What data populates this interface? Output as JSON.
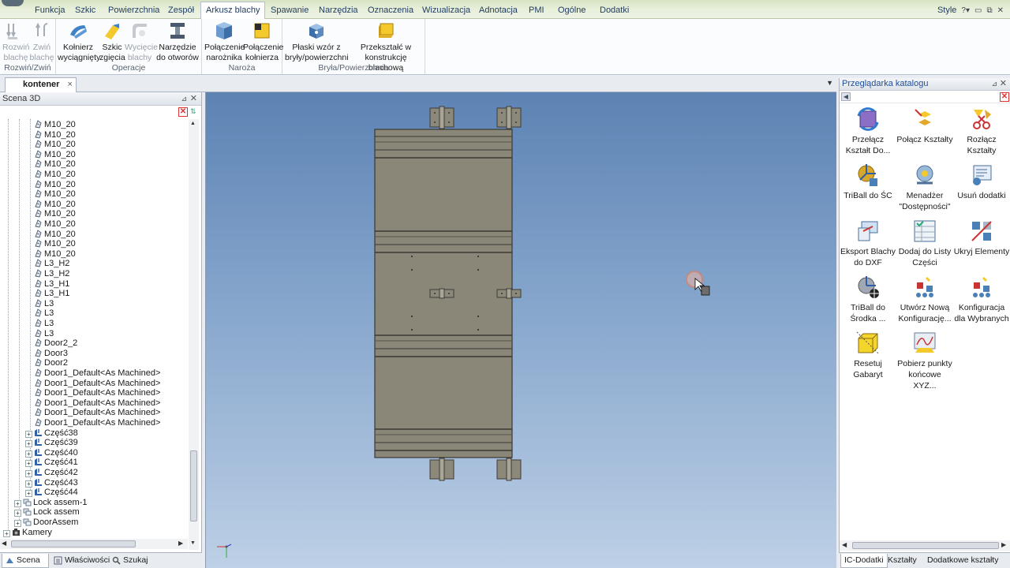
{
  "menu": {
    "tabs": [
      "Funkcja",
      "Szkic",
      "Powierzchnia",
      "Zespół",
      "Arkusz blachy",
      "Spawanie",
      "Narzędzia",
      "Oznaczenia",
      "Wizualizacja",
      "Adnotacja",
      "PMI",
      "Ogólne",
      "Dodatki"
    ],
    "active_tab": "Arkusz blachy",
    "style_label": "Style",
    "help_icon": "help-icon"
  },
  "ribbon": {
    "groups": {
      "rozwin": {
        "label": "Rozwiń/Zwiń",
        "buttons": [
          {
            "line1": "Rozwiń",
            "line2": "blachę",
            "enabled": false
          },
          {
            "line1": "Zwiń",
            "line2": "blachę",
            "enabled": false
          }
        ]
      },
      "operacje": {
        "label": "Operacje",
        "buttons": [
          {
            "line1": "Kołnierz",
            "line2": "wyciągnięty",
            "enabled": true
          },
          {
            "line1": "Szkic",
            "line2": "zgięcia",
            "enabled": true
          },
          {
            "line1": "Wycięcie",
            "line2": "blachy",
            "enabled": false
          },
          {
            "line1": "Narzędzie",
            "line2": "do otworów",
            "enabled": true
          }
        ]
      },
      "naroza": {
        "label": "Naroża",
        "buttons": [
          {
            "line1": "Połączenie",
            "line2": "narożnika",
            "enabled": true
          },
          {
            "line1": "Połączenie",
            "line2": "kołnierza",
            "enabled": true
          }
        ]
      },
      "bryla": {
        "label": "Bryła/Powierzchnia",
        "buttons": [
          {
            "line1": "Płaski wzór z",
            "line2": "bryły/powierzchni",
            "enabled": true
          },
          {
            "line1": "Przekształć w",
            "line2": "konstrukcję blachową",
            "enabled": true
          }
        ]
      }
    }
  },
  "document": {
    "tab_label": "kontener",
    "close_glyph": "×"
  },
  "scene_panel": {
    "title": "Scena 3D",
    "tree_items": [
      {
        "label": "M10_20",
        "level": 3,
        "icon": "part-icon"
      },
      {
        "label": "M10_20",
        "level": 3,
        "icon": "part-icon"
      },
      {
        "label": "M10_20",
        "level": 3,
        "icon": "part-icon"
      },
      {
        "label": "M10_20",
        "level": 3,
        "icon": "part-icon"
      },
      {
        "label": "M10_20",
        "level": 3,
        "icon": "part-icon"
      },
      {
        "label": "M10_20",
        "level": 3,
        "icon": "part-icon"
      },
      {
        "label": "M10_20",
        "level": 3,
        "icon": "part-icon"
      },
      {
        "label": "M10_20",
        "level": 3,
        "icon": "part-icon"
      },
      {
        "label": "M10_20",
        "level": 3,
        "icon": "part-icon"
      },
      {
        "label": "M10_20",
        "level": 3,
        "icon": "part-icon"
      },
      {
        "label": "M10_20",
        "level": 3,
        "icon": "part-icon"
      },
      {
        "label": "M10_20",
        "level": 3,
        "icon": "part-icon"
      },
      {
        "label": "M10_20",
        "level": 3,
        "icon": "part-icon"
      },
      {
        "label": "M10_20",
        "level": 3,
        "icon": "part-icon"
      },
      {
        "label": "L3_H2",
        "level": 3,
        "icon": "part-icon"
      },
      {
        "label": "L3_H2",
        "level": 3,
        "icon": "part-icon"
      },
      {
        "label": "L3_H1",
        "level": 3,
        "icon": "part-icon"
      },
      {
        "label": "L3_H1",
        "level": 3,
        "icon": "part-icon"
      },
      {
        "label": "L3",
        "level": 3,
        "icon": "part-icon"
      },
      {
        "label": "L3",
        "level": 3,
        "icon": "part-icon"
      },
      {
        "label": "L3",
        "level": 3,
        "icon": "part-icon"
      },
      {
        "label": "L3",
        "level": 3,
        "icon": "part-icon"
      },
      {
        "label": "Door2_2",
        "level": 3,
        "icon": "part-icon"
      },
      {
        "label": "Door3",
        "level": 3,
        "icon": "part-icon"
      },
      {
        "label": "Door2",
        "level": 3,
        "icon": "part-icon"
      },
      {
        "label": "Door1_Default<As Machined>",
        "level": 3,
        "icon": "part-icon"
      },
      {
        "label": "Door1_Default<As Machined>",
        "level": 3,
        "icon": "part-icon"
      },
      {
        "label": "Door1_Default<As Machined>",
        "level": 3,
        "icon": "part-icon"
      },
      {
        "label": "Door1_Default<As Machined>",
        "level": 3,
        "icon": "part-icon"
      },
      {
        "label": "Door1_Default<As Machined>",
        "level": 3,
        "icon": "part-icon"
      },
      {
        "label": "Door1_Default<As Machined>",
        "level": 3,
        "icon": "part-icon"
      },
      {
        "label": "Część38",
        "level": 3,
        "icon": "sheetmetal-part-icon",
        "expandable": true
      },
      {
        "label": "Część39",
        "level": 3,
        "icon": "sheetmetal-part-icon",
        "expandable": true
      },
      {
        "label": "Część40",
        "level": 3,
        "icon": "sheetmetal-part-icon",
        "expandable": true
      },
      {
        "label": "Część41",
        "level": 3,
        "icon": "sheetmetal-part-icon",
        "expandable": true
      },
      {
        "label": "Część42",
        "level": 3,
        "icon": "sheetmetal-part-icon",
        "expandable": true
      },
      {
        "label": "Część43",
        "level": 3,
        "icon": "sheetmetal-part-icon",
        "expandable": true
      },
      {
        "label": "Część44",
        "level": 3,
        "icon": "sheetmetal-part-icon",
        "expandable": true
      },
      {
        "label": "Lock assem-1",
        "level": 2,
        "icon": "assembly-icon",
        "expandable": true
      },
      {
        "label": "Lock assem",
        "level": 2,
        "icon": "assembly-icon",
        "expandable": true
      },
      {
        "label": "DoorAssem",
        "level": 2,
        "icon": "assembly-icon",
        "expandable": true
      },
      {
        "label": "Kamery",
        "level": 1,
        "icon": "camera-icon",
        "expandable": true
      }
    ],
    "bottom_tabs": [
      {
        "label": "Scena 3D",
        "icon": "scene-icon"
      },
      {
        "label": "Właściwości",
        "icon": "properties-icon"
      },
      {
        "label": "Szukaj",
        "icon": "search-icon"
      }
    ]
  },
  "catalog_panel": {
    "title": "Przeglądarka katalogu",
    "items": [
      {
        "label": "Przełącz Kształt Do...",
        "icon": "switch-shape-icon"
      },
      {
        "label": "Połącz Kształty",
        "icon": "join-shapes-icon"
      },
      {
        "label": "Rozłącz Kształty",
        "icon": "split-shapes-icon"
      },
      {
        "label": "TriBall do ŚC",
        "icon": "triball-center-icon"
      },
      {
        "label": "Menadżer \"Dostępności\"",
        "icon": "accessibility-manager-icon"
      },
      {
        "label": "Usuń dodatki",
        "icon": "remove-addins-icon"
      },
      {
        "label": "Eksport Blachy do DXF",
        "icon": "dxf-export-icon"
      },
      {
        "label": "Dodaj do Listy Części",
        "icon": "add-to-parts-list-icon"
      },
      {
        "label": "Ukryj Elementy",
        "icon": "hide-elements-icon"
      },
      {
        "label": "TriBall do Środka ...",
        "icon": "triball-middle-icon"
      },
      {
        "label": "Utwórz Nową Konfigurację...",
        "icon": "new-config-icon"
      },
      {
        "label": "Konfiguracja dla Wybranych",
        "icon": "selected-config-icon"
      },
      {
        "label": "Resetuj Gabaryt",
        "icon": "reset-bounds-icon"
      },
      {
        "label": "Pobierz punkty końcowe XYZ...",
        "icon": "xyz-endpoints-icon"
      }
    ],
    "bottom_tabs": [
      "IC-Dodatki",
      "Kształty",
      "Dodatkowe kształty"
    ]
  }
}
